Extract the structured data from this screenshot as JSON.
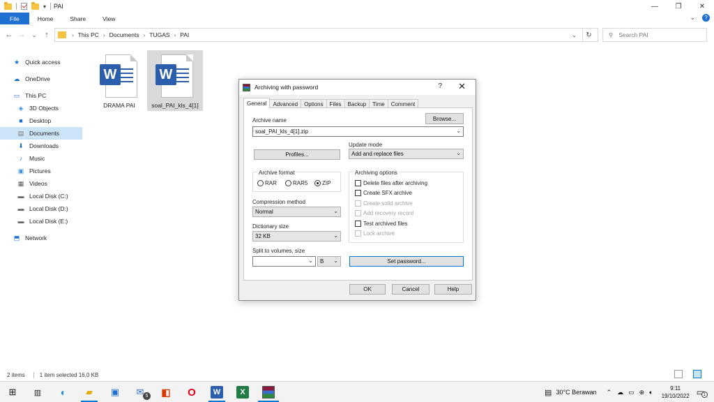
{
  "window": {
    "title": "PAI",
    "ribbon_tabs": [
      "File",
      "Home",
      "Share",
      "View"
    ]
  },
  "address": {
    "crumbs": [
      "This PC",
      "Documents",
      "TUGAS",
      "PAI"
    ],
    "search_placeholder": "Search PAI"
  },
  "sidebar": {
    "items": [
      {
        "label": "Quick access",
        "icon": "star-icon"
      },
      {
        "label": "OneDrive",
        "icon": "cloud-icon"
      },
      {
        "label": "This PC",
        "icon": "computer-icon"
      },
      {
        "label": "3D Objects",
        "icon": "cube-icon"
      },
      {
        "label": "Desktop",
        "icon": "desktop-icon"
      },
      {
        "label": "Documents",
        "icon": "document-icon"
      },
      {
        "label": "Downloads",
        "icon": "download-icon"
      },
      {
        "label": "Music",
        "icon": "music-icon"
      },
      {
        "label": "Pictures",
        "icon": "picture-icon"
      },
      {
        "label": "Videos",
        "icon": "video-icon"
      },
      {
        "label": "Local Disk (C:)",
        "icon": "disk-icon"
      },
      {
        "label": "Local Disk (D:)",
        "icon": "disk-icon"
      },
      {
        "label": "Local Disk (E:)",
        "icon": "disk-icon"
      },
      {
        "label": "Network",
        "icon": "network-icon"
      }
    ]
  },
  "files": [
    {
      "name": "DRAMA PAI",
      "icon": "word-document-icon"
    },
    {
      "name": "soal_PAI_kls_4[1]",
      "icon": "word-document-icon"
    }
  ],
  "dialog": {
    "title": "Archiving with password",
    "help": "?",
    "close": "✕",
    "tabs": [
      "General",
      "Advanced",
      "Options",
      "Files",
      "Backup",
      "Time",
      "Comment"
    ],
    "archive_name_label": "Archive name",
    "archive_name_value": "soal_PAI_kls_4[1].zip",
    "browse_label": "Browse...",
    "profiles_label": "Profiles...",
    "update_mode_label": "Update mode",
    "update_mode_value": "Add and replace files",
    "archive_format_label": "Archive format",
    "formats": [
      "RAR",
      "RAR5",
      "ZIP"
    ],
    "selected_format": "ZIP",
    "compression_label": "Compression method",
    "compression_value": "Normal",
    "dictionary_label": "Dictionary size",
    "dictionary_value": "32 KB",
    "split_label": "Split to volumes, size",
    "split_value": "",
    "split_unit": "B",
    "archiving_options_label": "Archiving options",
    "options": [
      {
        "label": "Delete files after archiving",
        "enabled": true,
        "checked": false
      },
      {
        "label": "Create SFX archive",
        "enabled": true,
        "checked": false
      },
      {
        "label": "Create solid archive",
        "enabled": false,
        "checked": false
      },
      {
        "label": "Add recovery record",
        "enabled": false,
        "checked": false
      },
      {
        "label": "Test archived files",
        "enabled": true,
        "checked": false
      },
      {
        "label": "Lock archive",
        "enabled": false,
        "checked": false
      }
    ],
    "set_password_label": "Set password...",
    "ok_label": "OK",
    "cancel_label": "Cancel",
    "help_label": "Help"
  },
  "statusbar": {
    "items_count": "2 items",
    "selection": "1 item selected  16,0 KB"
  },
  "taskbar": {
    "weather": "30°C  Berawan",
    "time": "9:11",
    "date": "19/10/2022",
    "mail_badge": "5",
    "notification_badge": "1"
  },
  "colors": {
    "accent": "#1e6fcf",
    "selection": "#cce4f7",
    "word_blue": "#2b5fad"
  }
}
